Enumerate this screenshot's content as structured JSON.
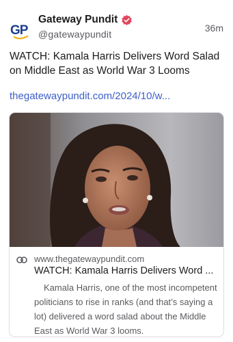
{
  "author": {
    "avatar_text": "GP",
    "name": "Gateway Pundit",
    "handle": "@gatewaypundit"
  },
  "post": {
    "time": "36m",
    "text": "WATCH: Kamala Harris Delivers Word Salad on Middle East as World War 3 Looms",
    "link": "thegatewaypundit.com/2024/10/w..."
  },
  "card": {
    "domain": "www.thegatewaypundit.com",
    "title": "WATCH: Kamala Harris Delivers Word ...",
    "description": "Kamala Harris, one of the most incompetent politicians to rise in ranks (and that’s saying a lot) delivered a word salad about the Middle East as World War 3 looms."
  },
  "icons": {
    "verified": "verified-badge-icon",
    "link": "link-icon"
  },
  "colors": {
    "link": "#3d5ec9",
    "verified": "#e0465e",
    "avatar_blue": "#1d3f8f",
    "avatar_yellow": "#f2b21b"
  }
}
